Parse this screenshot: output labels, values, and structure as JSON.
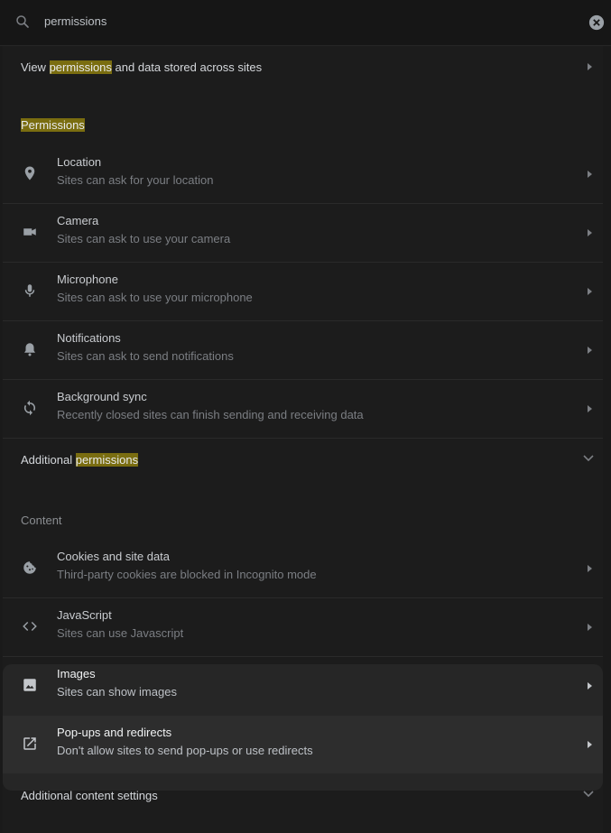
{
  "search": {
    "value": "permissions"
  },
  "view_row": {
    "before": "View ",
    "highlight": "permissions",
    "after": " and data stored across sites"
  },
  "permissions_header": "Permissions",
  "permission_items": [
    {
      "title": "Location",
      "subtitle": "Sites can ask for your location",
      "icon": "location-pin-icon"
    },
    {
      "title": "Camera",
      "subtitle": "Sites can ask to use your camera",
      "icon": "camera-icon"
    },
    {
      "title": "Microphone",
      "subtitle": "Sites can ask to use your microphone",
      "icon": "microphone-icon"
    },
    {
      "title": "Notifications",
      "subtitle": "Sites can ask to send notifications",
      "icon": "bell-icon"
    },
    {
      "title": "Background sync",
      "subtitle": "Recently closed sites can finish sending and receiving data",
      "icon": "sync-icon"
    }
  ],
  "additional_permissions": {
    "before": "Additional ",
    "highlight": "permissions"
  },
  "content_header": "Content",
  "content_items": [
    {
      "title": "Cookies and site data",
      "subtitle": "Third-party cookies are blocked in Incognito mode",
      "icon": "cookie-icon"
    },
    {
      "title": "JavaScript",
      "subtitle": "Sites can use Javascript",
      "icon": "code-brackets-icon"
    },
    {
      "title": "Images",
      "subtitle": "Sites can show images",
      "icon": "image-icon"
    },
    {
      "title": "Pop-ups and redirects",
      "subtitle": "Don't allow sites to send pop-ups or use redirects",
      "icon": "open-external-icon"
    }
  ],
  "additional_content": "Additional content settings",
  "colors": {
    "background": "#1a1a1a",
    "highlight": "#7a6d10",
    "hover_row": "#2d2d2d"
  }
}
